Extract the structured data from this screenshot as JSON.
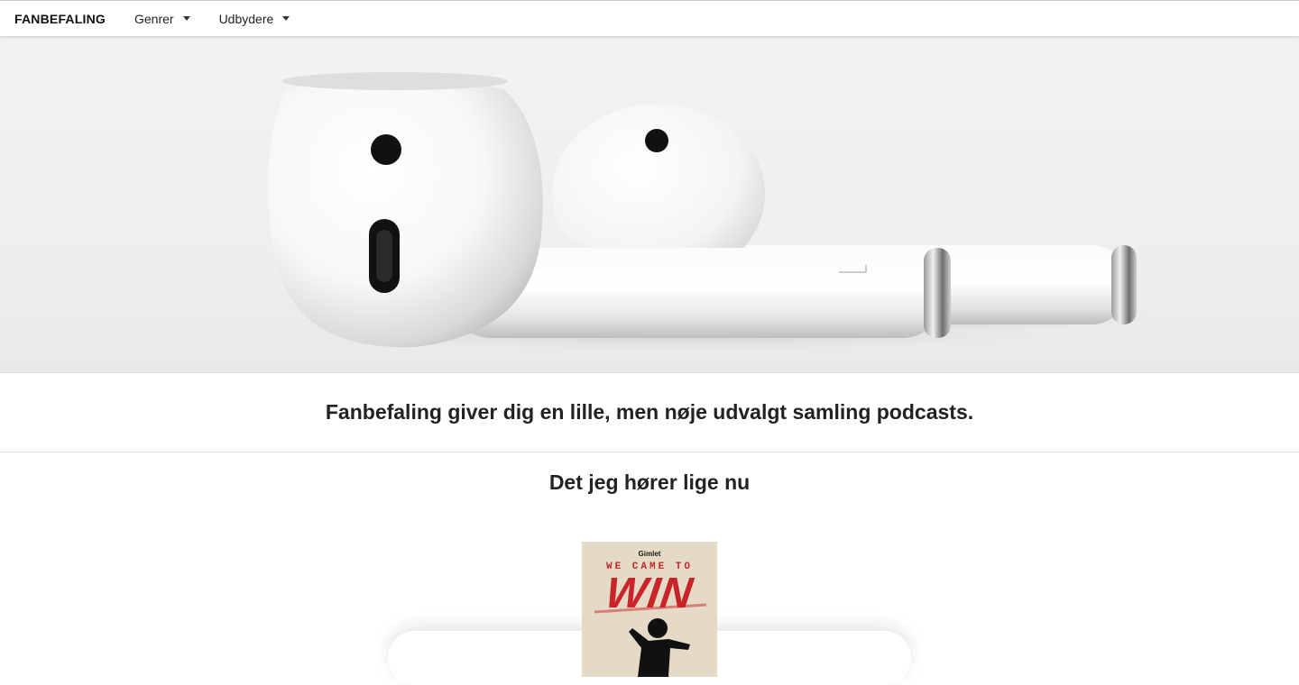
{
  "nav": {
    "brand": "FANBEFALING",
    "genres_label": "Genrer",
    "providers_label": "Udbydere"
  },
  "hero": {
    "image": "white-earbuds-photo"
  },
  "tagline": "Fanbefaling giver dig en lille, men nøje udvalgt samling podcasts.",
  "current_section": {
    "title": "Det jeg hører lige nu",
    "podcast": {
      "publisher": "Gimlet",
      "title_line1": "WE CAME TO",
      "title_line2": "WIN"
    }
  },
  "colors": {
    "cover_red": "#c9242a",
    "cover_background": "#e9dfcd",
    "text": "#222222"
  }
}
